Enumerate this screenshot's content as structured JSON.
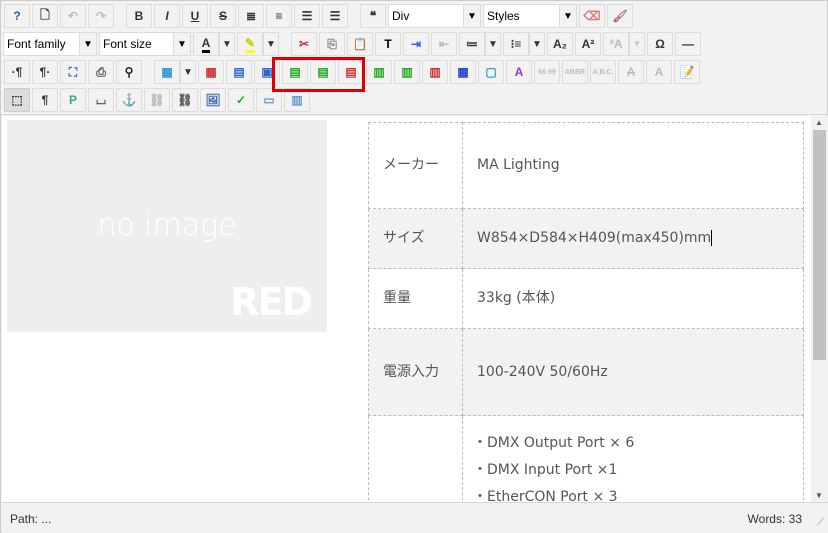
{
  "toolbar": {
    "row1": [
      {
        "n": "help-button",
        "g": "?",
        "c": "#2a5db0"
      },
      {
        "n": "new-document-button",
        "g": "🗋"
      },
      {
        "n": "undo-button",
        "g": "↶",
        "d": true
      },
      {
        "n": "redo-button",
        "g": "↷",
        "d": true
      },
      {
        "sep": true
      },
      {
        "n": "bold-button",
        "g": "B"
      },
      {
        "n": "italic-button",
        "g": "I"
      },
      {
        "n": "underline-button",
        "g": "U"
      },
      {
        "n": "strikethrough-button",
        "g": "S"
      },
      {
        "n": "justify-full-button",
        "g": "≣"
      },
      {
        "n": "justify-center-button",
        "g": "≡"
      },
      {
        "n": "justify-left-button",
        "g": "☰"
      },
      {
        "n": "justify-right-button",
        "g": "☰"
      },
      {
        "sep": true
      },
      {
        "n": "blockquote-button",
        "g": "❝"
      },
      {
        "sel": "Div",
        "w": 93,
        "n": "format-select"
      },
      {
        "sel": "Styles",
        "w": 94,
        "n": "styles-select"
      },
      {
        "n": "remove-format-button",
        "g": "⌫",
        "c": "#d77"
      },
      {
        "n": "cleanup-button",
        "g": "🖌",
        "c": "#a66"
      }
    ],
    "row2": [
      {
        "sel": "Font family",
        "w": 94,
        "n": "font-family-select"
      },
      {
        "sel": "Font size",
        "w": 92,
        "n": "font-size-select"
      },
      {
        "n": "text-color-button",
        "g": "A",
        "u": "#000"
      },
      {
        "arrow": true,
        "n": "text-color-dropdown"
      },
      {
        "n": "highlight-color-button",
        "g": "✎",
        "u": "#ff0",
        "c": "#cc0"
      },
      {
        "arrow": true,
        "n": "highlight-color-dropdown"
      },
      {
        "sep": true
      },
      {
        "n": "cut-button",
        "g": "✂",
        "c": "#c33"
      },
      {
        "n": "copy-button",
        "g": "⎘",
        "c": "#888"
      },
      {
        "n": "paste-button",
        "g": "📋",
        "c": "#a52"
      },
      {
        "n": "paste-text-button",
        "g": "T",
        "c": "#000"
      },
      {
        "n": "indent-button",
        "g": "⇥",
        "c": "#36c"
      },
      {
        "n": "outdent-button",
        "g": "⇤",
        "d": true
      },
      {
        "n": "ordered-list-button",
        "g": "≔"
      },
      {
        "arrow": true,
        "n": "ordered-list-dropdown"
      },
      {
        "n": "unordered-list-button",
        "g": "⁝≡"
      },
      {
        "arrow": true,
        "n": "unordered-list-dropdown"
      },
      {
        "n": "subscript-button",
        "g": "A₂"
      },
      {
        "n": "superscript-button",
        "g": "A²"
      },
      {
        "n": "text-direction-button",
        "g": "ªA",
        "d": true
      },
      {
        "arrow": true,
        "n": "text-direction-dropdown",
        "d": true
      },
      {
        "n": "special-char-button",
        "g": "Ω"
      },
      {
        "n": "horizontal-rule-button",
        "g": "—"
      }
    ],
    "row3": [
      {
        "n": "ltr-button",
        "g": "·¶"
      },
      {
        "n": "rtl-button",
        "g": "¶·"
      },
      {
        "n": "fullscreen-button",
        "g": "⛶",
        "c": "#36c"
      },
      {
        "n": "print-button",
        "g": "⎙",
        "c": "#555"
      },
      {
        "n": "find-button",
        "g": "⚲",
        "c": "#222"
      },
      {
        "sep": true
      },
      {
        "n": "table-button",
        "g": "▦",
        "c": "#39c"
      },
      {
        "arrow": true,
        "n": "table-dropdown"
      },
      {
        "n": "delete-table-button",
        "g": "▦",
        "c": "#c33"
      },
      {
        "n": "row-properties-button",
        "g": "▤",
        "c": "#36c"
      },
      {
        "n": "cell-properties-button",
        "g": "▣",
        "c": "#36c"
      },
      {
        "n": "insert-row-before-button",
        "g": "▤",
        "c": "#2a2"
      },
      {
        "n": "insert-row-after-button",
        "g": "▤",
        "c": "#2a2"
      },
      {
        "n": "delete-row-button",
        "g": "▤",
        "c": "#c33"
      },
      {
        "n": "insert-column-before-button",
        "g": "▥",
        "c": "#2a2"
      },
      {
        "n": "insert-column-after-button",
        "g": "▥",
        "c": "#2a2"
      },
      {
        "n": "delete-column-button",
        "g": "▥",
        "c": "#c33"
      },
      {
        "n": "merge-cells-button",
        "g": "▦",
        "c": "#24c"
      },
      {
        "n": "split-cells-button",
        "g": "▢",
        "c": "#39c"
      },
      {
        "n": "styleprops-button",
        "g": "A",
        "c": "#93c"
      },
      {
        "n": "cite-button",
        "g": "66 99",
        "d": true
      },
      {
        "n": "abbr-button",
        "g": "ABBR",
        "d": true
      },
      {
        "n": "acronym-button",
        "g": "A.B.C.",
        "d": true
      },
      {
        "n": "delete-text-button",
        "g": "A",
        "d": true
      },
      {
        "n": "insert-text-button",
        "g": "A",
        "d": true
      },
      {
        "n": "attributes-button",
        "g": "📝",
        "c": "#a72"
      }
    ],
    "row4": [
      {
        "n": "visual-aid-button",
        "g": "⬚",
        "a": true
      },
      {
        "n": "paragraph-button",
        "g": "¶"
      },
      {
        "n": "preview-button",
        "g": "P",
        "c": "#3a8"
      },
      {
        "n": "pagebreak-button",
        "g": "⌴"
      },
      {
        "n": "anchor-button",
        "g": "⚓",
        "c": "#666"
      },
      {
        "n": "unlink-button",
        "g": "⛓",
        "d": true
      },
      {
        "n": "link-button",
        "g": "⛓",
        "c": "#555"
      },
      {
        "n": "image-button",
        "g": "🖼",
        "c": "#36a"
      },
      {
        "n": "spellcheck-button",
        "g": "✓",
        "c": "#2a2"
      },
      {
        "n": "template-button",
        "g": "▭",
        "c": "#69c"
      },
      {
        "n": "layer-button",
        "g": "▥",
        "c": "#69c"
      }
    ]
  },
  "content": {
    "image_placeholder": "no image",
    "logo": "RED",
    "table": [
      {
        "key": "メーカー",
        "value": "MA Lighting"
      },
      {
        "key": "サイズ",
        "value": "W854×D584×H409(max450)mm"
      },
      {
        "key": "重量",
        "value": "33kg (本体)"
      },
      {
        "key": "電源入力",
        "value": "100-240V 50/60Hz"
      },
      {
        "key": "",
        "values": [
          "・DMX Output Port × 6",
          "・DMX Input Port ×1",
          "・EtherCON Port × 3"
        ]
      }
    ]
  },
  "status": {
    "path": "Path: ...",
    "words": "Words: 33"
  }
}
